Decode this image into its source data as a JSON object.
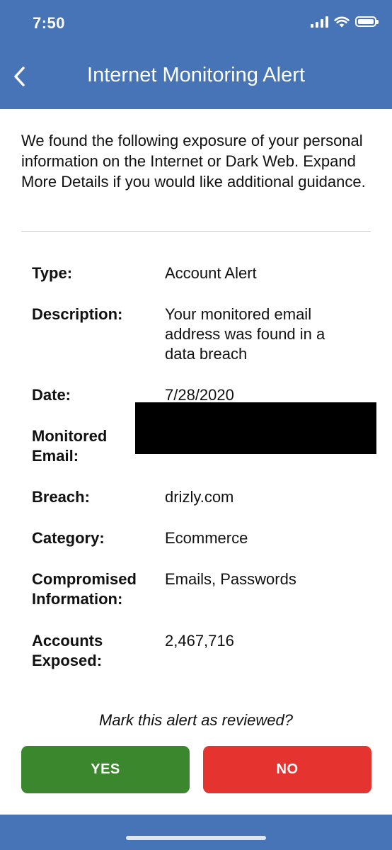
{
  "status_bar": {
    "time": "7:50"
  },
  "header": {
    "title": "Internet Monitoring Alert",
    "back_icon": "chevron-left-icon"
  },
  "intro_text": "We found the following exposure of your personal information on the Internet or Dark Web. Expand More Details if you would like additional guidance.",
  "details": {
    "type": {
      "label": "Type:",
      "value": "Account Alert"
    },
    "description": {
      "label": "Description:",
      "value": "Your monitored email address was found in a data breach"
    },
    "date": {
      "label": "Date:",
      "value": "7/28/2020"
    },
    "monitored_email": {
      "label_line1": "Monitored",
      "label_line2": "Email:"
    },
    "breach": {
      "label": "Breach:",
      "value": "drizly.com"
    },
    "category": {
      "label": "Category:",
      "value": "Ecommerce"
    },
    "compromised": {
      "label_line1": "Compromised",
      "label_line2": "Information:",
      "value": "Emails, Passwords"
    },
    "accounts": {
      "label_line1": "Accounts",
      "label_line2": "Exposed:",
      "value": "2,467,716"
    }
  },
  "review": {
    "question": "Mark this alert as reviewed?",
    "yes_label": "YES",
    "no_label": "NO"
  },
  "colors": {
    "brand_blue": "#4674b6",
    "yes_green": "#3b872e",
    "no_red": "#e5332f"
  }
}
